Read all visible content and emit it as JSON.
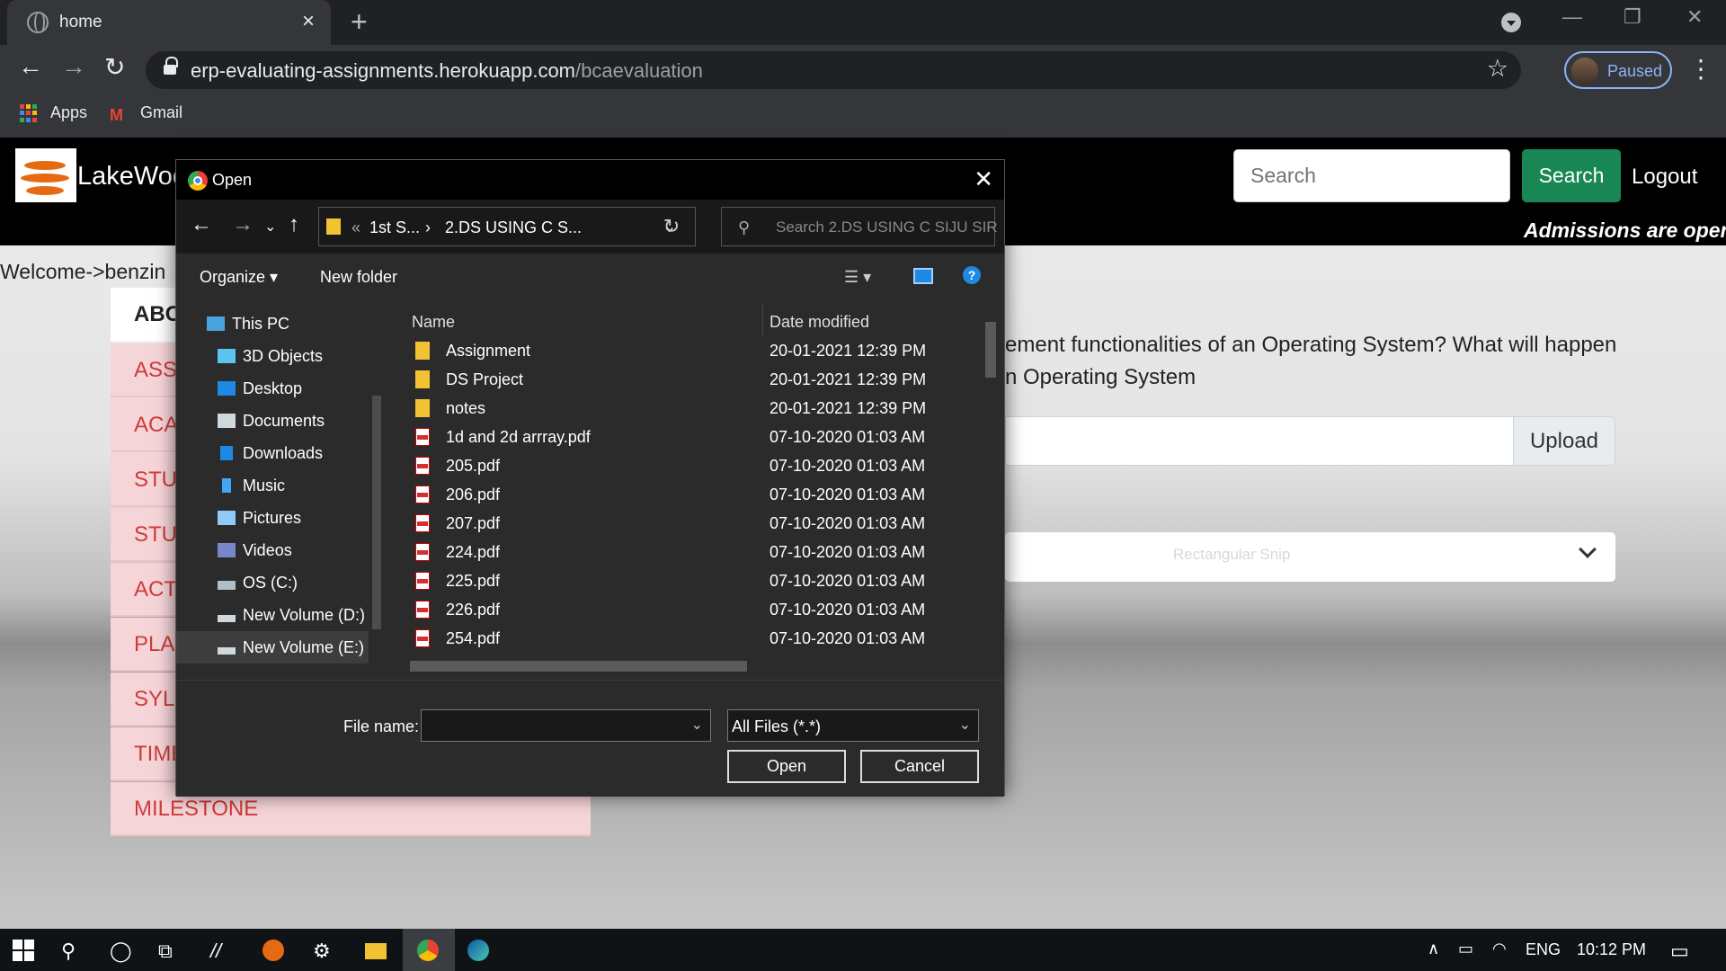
{
  "browser": {
    "tab_title": "home",
    "url_host": "erp-evaluating-assignments.herokuapp.com",
    "url_path": "/bcaevaluation",
    "profile_label": "Paused",
    "bookmarks": [
      "Apps",
      "Gmail"
    ]
  },
  "site": {
    "brand": "LakeWoo",
    "search_placeholder": "Search",
    "search_button": "Search",
    "logout": "Logout",
    "marquee": "Admissions are open f",
    "welcome": "Welcome->benzin",
    "menu_header": "ABO",
    "menu_items": [
      "ASSI",
      "ACA",
      "STUD",
      "STUD",
      "ACTI",
      "PLAC",
      "SYLL",
      "TIME",
      "MILESTONE"
    ],
    "question_line1": "ement functionalities of an Operating System? What will happen",
    "question_line2": "n Operating System",
    "upload_button": "Upload",
    "ghost_text": "Rectangular Snip"
  },
  "dialog": {
    "title": "Open",
    "breadcrumb": [
      "«",
      "1st S...",
      "›",
      "2.DS USING C S..."
    ],
    "search_placeholder": "Search 2.DS USING C SIJU SIR",
    "organize": "Organize ▾",
    "new_folder": "New folder",
    "nav_items": [
      "This PC",
      "3D Objects",
      "Desktop",
      "Documents",
      "Downloads",
      "Music",
      "Pictures",
      "Videos",
      "OS (C:)",
      "New Volume (D:)",
      "New Volume (E:)"
    ],
    "col_name": "Name",
    "col_date": "Date modified",
    "files": [
      {
        "name": "Assignment",
        "date": "20-01-2021 12:39 PM",
        "type": "folder"
      },
      {
        "name": "DS Project",
        "date": "20-01-2021 12:39 PM",
        "type": "folder"
      },
      {
        "name": "notes",
        "date": "20-01-2021 12:39 PM",
        "type": "folder"
      },
      {
        "name": "1d and 2d arrray.pdf",
        "date": "07-10-2020 01:03 AM",
        "type": "pdf"
      },
      {
        "name": "205.pdf",
        "date": "07-10-2020 01:03 AM",
        "type": "pdf"
      },
      {
        "name": "206.pdf",
        "date": "07-10-2020 01:03 AM",
        "type": "pdf"
      },
      {
        "name": "207.pdf",
        "date": "07-10-2020 01:03 AM",
        "type": "pdf"
      },
      {
        "name": "224.pdf",
        "date": "07-10-2020 01:03 AM",
        "type": "pdf"
      },
      {
        "name": "225.pdf",
        "date": "07-10-2020 01:03 AM",
        "type": "pdf"
      },
      {
        "name": "226.pdf",
        "date": "07-10-2020 01:03 AM",
        "type": "pdf"
      },
      {
        "name": "254.pdf",
        "date": "07-10-2020 01:03 AM",
        "type": "pdf"
      }
    ],
    "file_name_label": "File name:",
    "file_name_value": "",
    "file_type": "All Files (*.*)",
    "open_button": "Open",
    "cancel_button": "Cancel"
  },
  "taskbar": {
    "language": "ENG",
    "time": "10:12 PM"
  }
}
